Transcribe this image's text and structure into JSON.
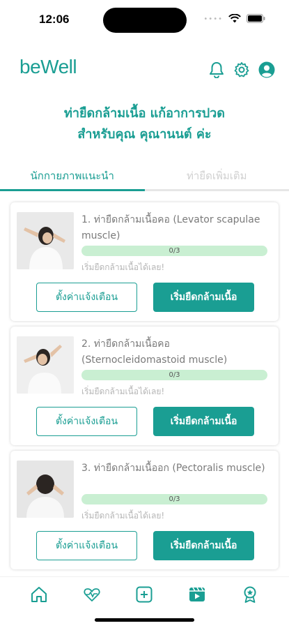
{
  "status_bar": {
    "time": "12:06"
  },
  "header": {
    "logo": "beWell",
    "icons": [
      "bell-icon",
      "gear-icon",
      "user-icon"
    ]
  },
  "headline": {
    "line1": "ท่ายืดกล้ามเนื้อ แก้อาการปวด",
    "line2": "สำหรับคุณ คุณานนต์ ค่ะ"
  },
  "tabs": [
    {
      "label": "นักกายภาพแนะนำ",
      "active": true
    },
    {
      "label": "ท่ายืดเพิ่มเติม",
      "active": false
    }
  ],
  "exercises": [
    {
      "title": "1. ท่ายืดกล้ามเนื้อคอ (Levator scapulae muscle)",
      "progress_text": "0/3",
      "progress": 0,
      "status": "เริ่มยืดกล้ามเนื้อได้เลย!",
      "reminder_label": "ตั้งค่าแจ้งเตือน",
      "start_label": "เริ่มยืดกล้ามเนื้อ"
    },
    {
      "title": "2. ท่ายืดกล้ามเนื้อคอ (Sternocleidomastoid muscle)",
      "progress_text": "0/3",
      "progress": 0,
      "status": "เริ่มยืดกล้ามเนื้อได้เลย!",
      "reminder_label": "ตั้งค่าแจ้งเตือน",
      "start_label": "เริ่มยืดกล้ามเนื้อ"
    },
    {
      "title": "3. ท่ายืดกล้ามเนื้ออก (Pectoralis muscle)",
      "progress_text": "0/3",
      "progress": 0,
      "status": "เริ่มยืดกล้ามเนื้อได้เลย!",
      "reminder_label": "ตั้งค่าแจ้งเตือน",
      "start_label": "เริ่มยืดกล้ามเนื้อ"
    }
  ],
  "bottom_nav": [
    "home-icon",
    "heart-pulse-icon",
    "plus-square-icon",
    "video-icon",
    "award-icon"
  ],
  "colors": {
    "accent": "#1a9e93",
    "progress_track": "#c9efd2"
  }
}
